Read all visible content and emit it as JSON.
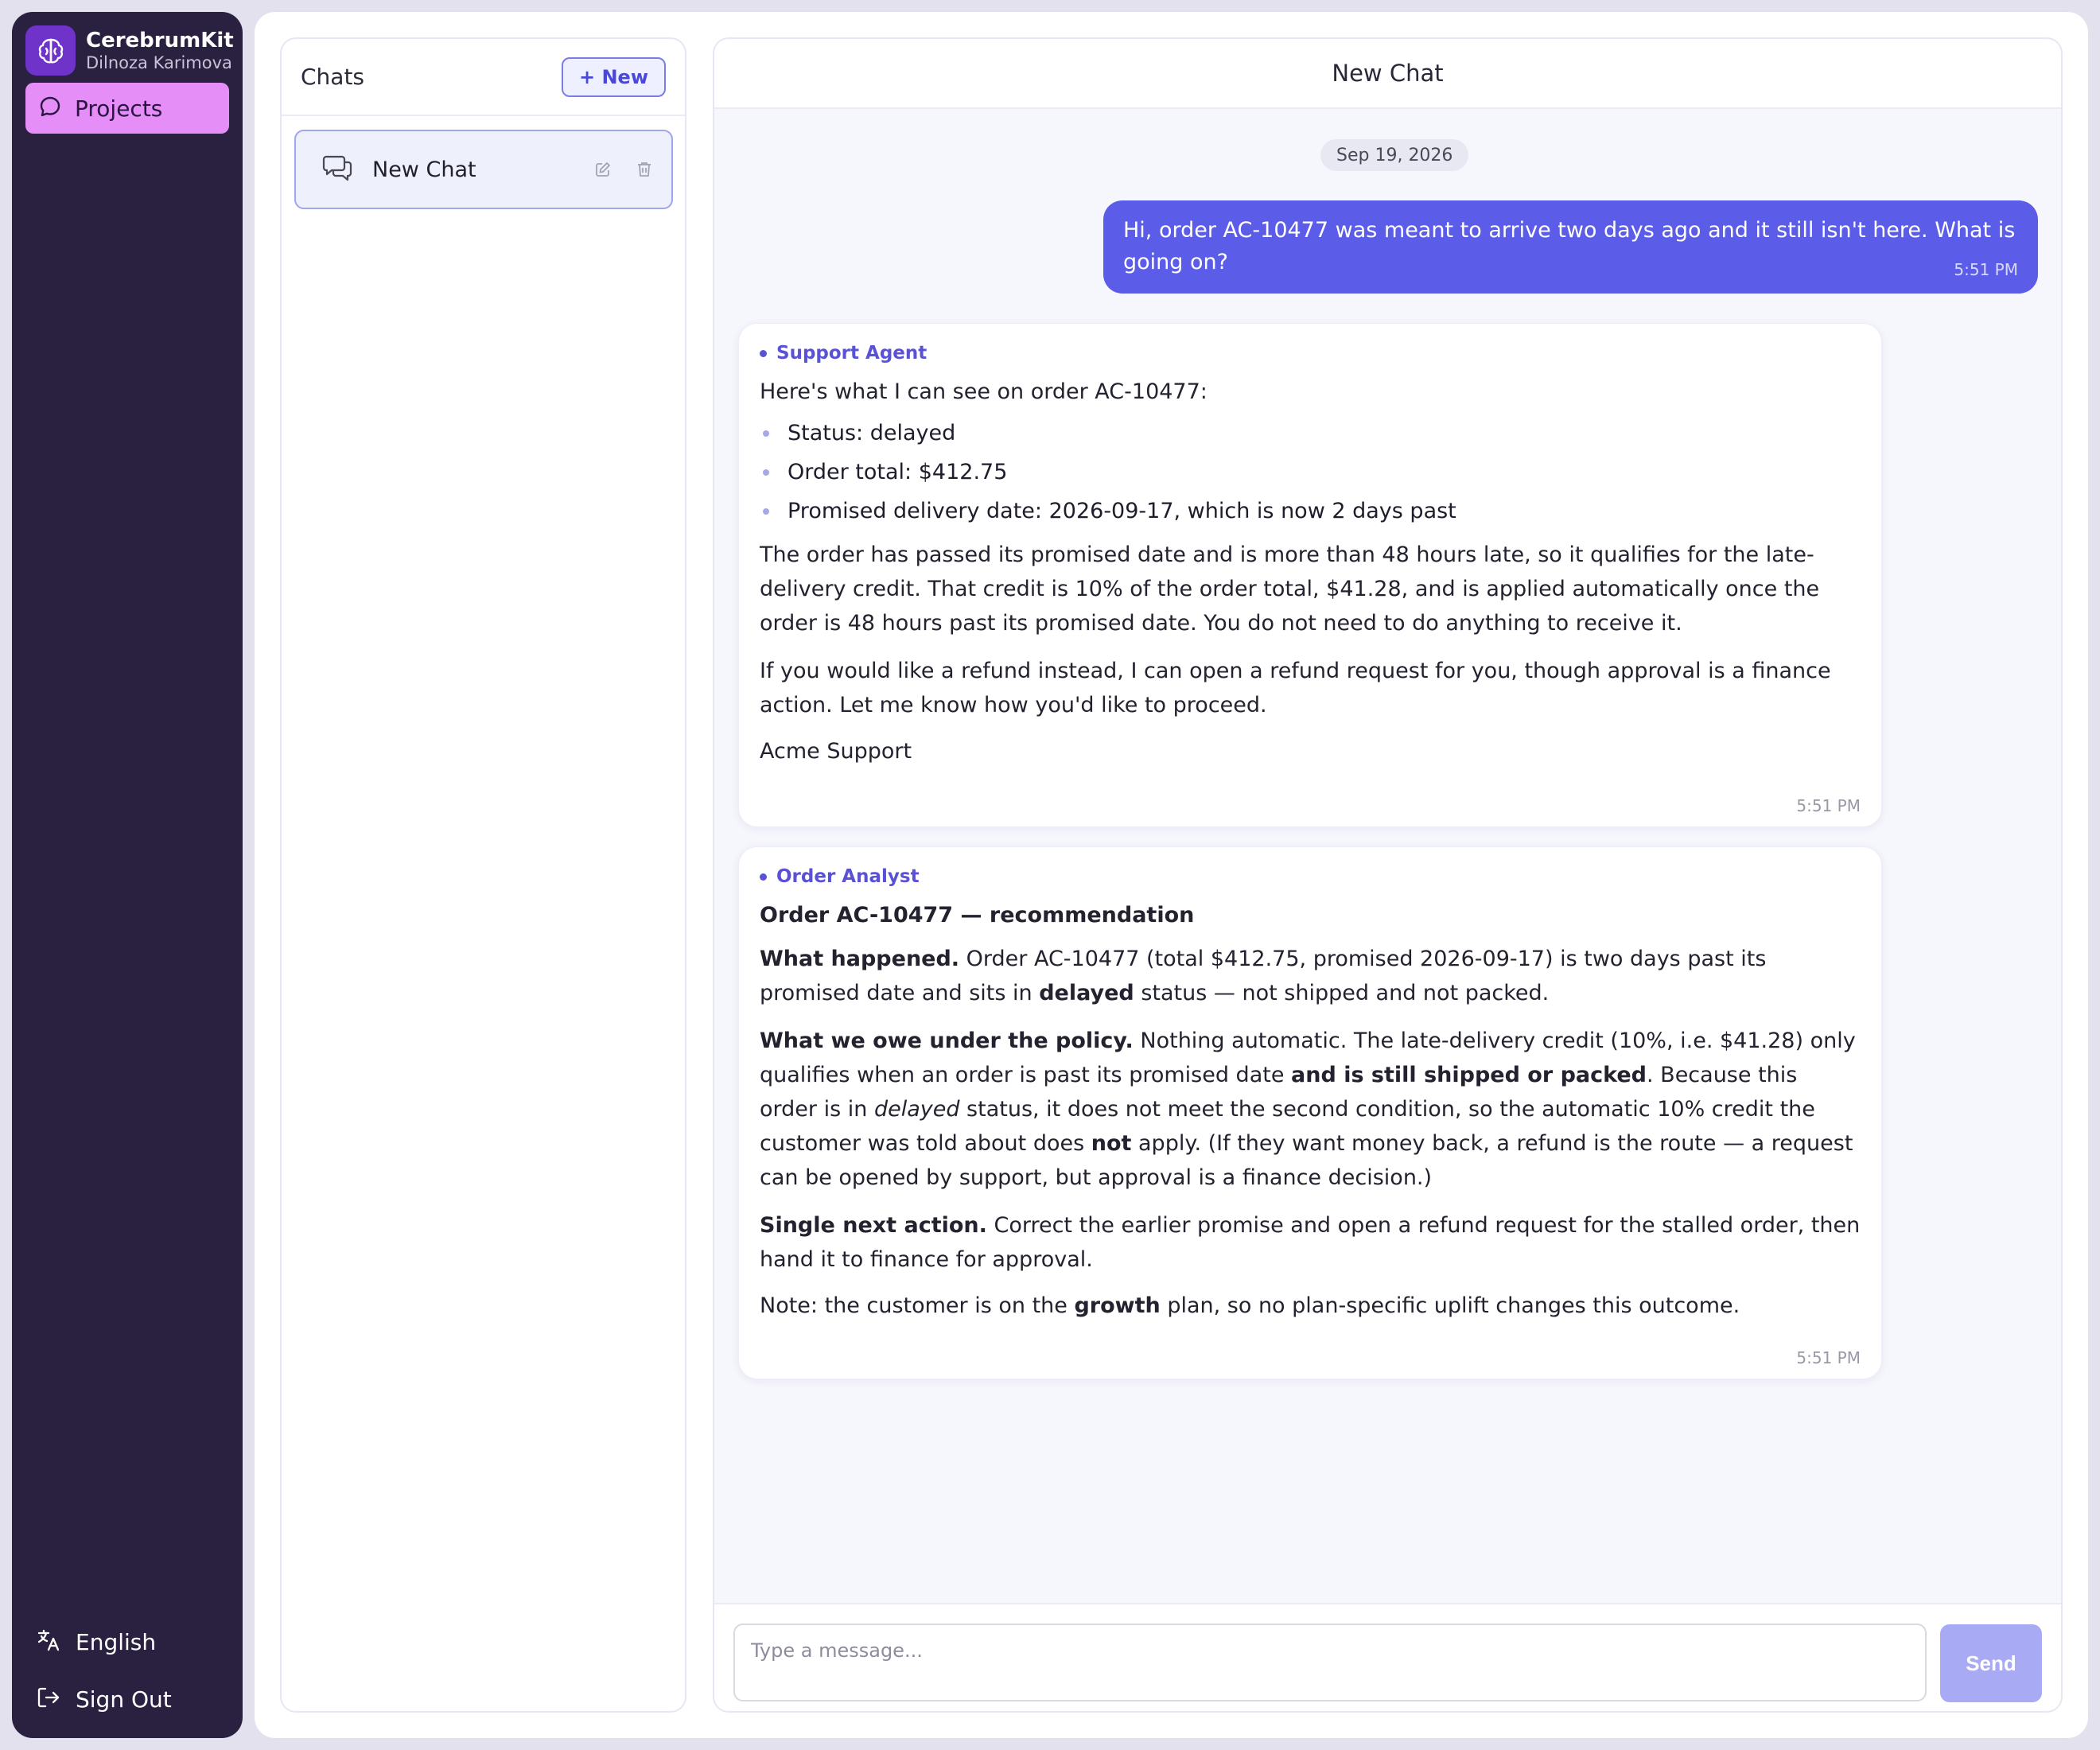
{
  "sidebar": {
    "brand_name": "CerebrumKit",
    "user_name": "Dilnoza Karimova",
    "nav": {
      "projects_label": "Projects"
    },
    "language_label": "English",
    "signout_label": "Sign Out"
  },
  "chats": {
    "title": "Chats",
    "new_button": "+ New",
    "items": [
      {
        "label": "New Chat"
      }
    ]
  },
  "conversation": {
    "title": "New Chat",
    "date": "Sep 19, 2026",
    "user_message": {
      "text": "Hi, order AC-10477 was meant to arrive two days ago and it still isn't here. What is going on?",
      "time": "5:51 PM"
    },
    "support_reply": {
      "agent": "Support Agent",
      "intro": "Here's what I can see on order AC-10477:",
      "bullets": [
        "Status: delayed",
        "Order total: $412.75",
        "Promised delivery date: 2026-09-17, which is now 2 days past"
      ],
      "para1": "The order has passed its promised date and is more than 48 hours late, so it qualifies for the late-delivery credit. That credit is 10% of the order total, $41.28, and is applied automatically once the order is 48 hours past its promised date. You do not need to do anything to receive it.",
      "para2": "If you would like a refund instead, I can open a refund request for you, though approval is a finance action. Let me know how you'd like to proceed.",
      "signature": "Acme Support",
      "time": "5:51 PM"
    },
    "analyst_reply": {
      "agent": "Order Analyst",
      "heading": "Order AC-10477 — recommendation",
      "p1_label": "What happened.",
      "p1_a": " Order AC-10477 (total $412.75, promised 2026-09-17) is two days past its promised date and sits in ",
      "p1_b": "delayed",
      "p1_c": " status — not shipped and not packed.",
      "p2_label": "What we owe under the policy.",
      "p2_a": " Nothing automatic. The late-delivery credit (10%, i.e. $41.28) only qualifies when an order is past its promised date ",
      "p2_b": "and is still shipped or packed",
      "p2_c": ". Because this order is in ",
      "p2_d": "delayed",
      "p2_e": " status, it does not meet the second condition, so the automatic 10% credit the customer was told about does ",
      "p2_f": "not",
      "p2_g": " apply. (If they want money back, a refund is the route — a request can be opened by support, but approval is a finance decision.)",
      "p3_label": "Single next action.",
      "p3_a": " Correct the earlier promise and open a refund request for the stalled order, then hand it to finance for approval.",
      "p4_a": "Note: the customer is on the ",
      "p4_b": "growth",
      "p4_c": " plan, so no plan-specific uplift changes this outcome.",
      "time": "5:51 PM"
    },
    "composer": {
      "placeholder": "Type a message...",
      "send_label": "Send"
    }
  },
  "colors": {
    "sidebar_bg": "#2a2140",
    "accent": "#5b5ce7",
    "projects_active": "#e58ef7",
    "send_disabled": "#a8aaf3"
  }
}
